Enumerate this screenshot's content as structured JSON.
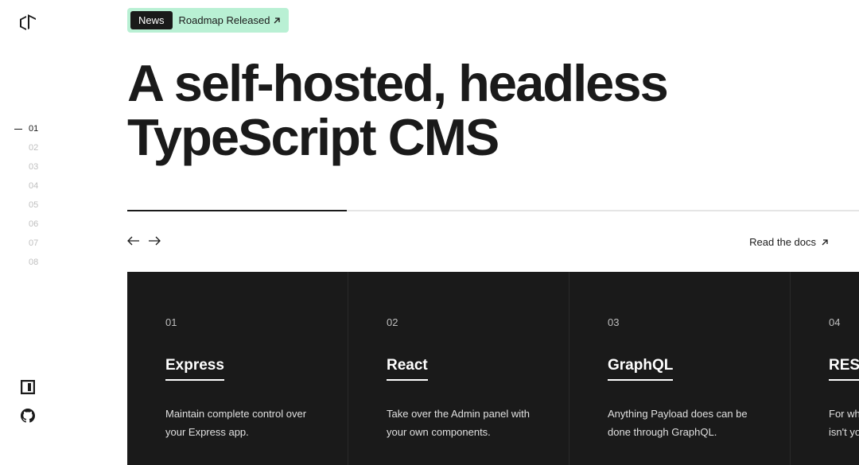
{
  "news": {
    "badge": "News",
    "text": "Roadmap Released"
  },
  "hero": {
    "title_line1": "A self-hosted, headless",
    "title_line2": "TypeScript CMS"
  },
  "indicators": [
    "01",
    "02",
    "03",
    "04",
    "05",
    "06",
    "07",
    "08"
  ],
  "docs_link": "Read the docs",
  "cards": [
    {
      "num": "01",
      "title": "Express",
      "desc": "Maintain complete control over your Express app."
    },
    {
      "num": "02",
      "title": "React",
      "desc": "Take over the Admin panel with your own components."
    },
    {
      "num": "03",
      "title": "GraphQL",
      "desc": "Anything Payload does can be done through GraphQL."
    },
    {
      "num": "04",
      "title": "REST",
      "desc": "For when GraphQL isn't your thing."
    }
  ]
}
